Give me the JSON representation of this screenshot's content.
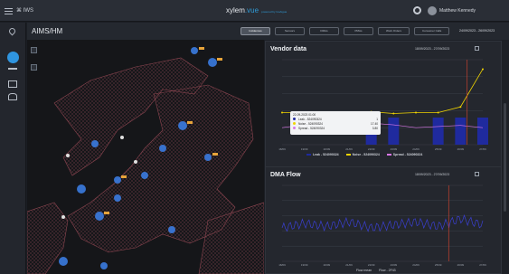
{
  "header": {
    "app_name": "IWS",
    "brand": "xylem",
    "brand_accent": "vue",
    "brand_tag": "powered by GoAigua",
    "user_name": "Matthew Kennedy"
  },
  "breadcrumb": "AIMS/HM",
  "tabs": [
    {
      "label": "Incidences",
      "active": true
    },
    {
      "label": "Sensors",
      "active": false
    },
    {
      "label": "DMAs",
      "active": false
    },
    {
      "label": "PMAs",
      "active": false
    },
    {
      "label": "Work Orders",
      "active": false
    },
    {
      "label": "Consumer Calls",
      "active": false
    }
  ],
  "global_date_range": "24/09/2023 - 26/09/2023",
  "vendor_panel": {
    "title": "Vendor data",
    "date_range": "18/09/2023 - 27/09/2023",
    "legend": [
      "Leak - 524090324",
      "Noise - 524090324",
      "Spread - 524090324"
    ],
    "tooltip": {
      "timestamp": "22-09-2023 01:00",
      "rows": [
        {
          "label": "Leak - 524090324",
          "value": "1"
        },
        {
          "label": "Noise - 524090324",
          "value": "17.40"
        },
        {
          "label": "Spread - 524090324",
          "value": "3.80"
        }
      ]
    }
  },
  "flow_panel": {
    "title": "DMA Flow",
    "date_range": "18/09/2023 - 27/09/2023",
    "legend": [
      "Flow mean",
      "Flow - 2F43"
    ]
  },
  "colors": {
    "accent": "#2f95e0",
    "leak": "#1f2a9e",
    "noise": "#f0d400",
    "spread": "#d977e6",
    "flow": "#3a3fd0",
    "alert": "#e0452f"
  },
  "icons": [
    "menu-icon",
    "flag-icon",
    "gear-icon",
    "calendar-icon",
    "pin-icon",
    "drop-icon",
    "truck-icon",
    "layers-icon",
    "bell-icon"
  ],
  "chart_data": [
    {
      "type": "bar",
      "title": "Vendor data",
      "categories": [
        "18/09",
        "19/09",
        "20/09",
        "21/09",
        "22/09",
        "23/09",
        "24/09",
        "25/09",
        "26/09",
        "27/09"
      ],
      "series": [
        {
          "name": "Leak - 524090324",
          "type": "bar",
          "values": [
            0,
            0,
            0,
            0,
            1,
            1,
            0,
            1,
            1,
            1
          ]
        },
        {
          "name": "Noise - 524090324",
          "type": "line",
          "values": [
            17,
            17,
            17,
            17,
            17.4,
            16.5,
            17,
            17,
            20,
            40
          ]
        },
        {
          "name": "Spread - 524090324",
          "type": "line",
          "values": [
            3,
            3.5,
            3,
            3.2,
            3.8,
            3.5,
            3,
            3.2,
            3.4,
            3
          ]
        }
      ]
    },
    {
      "type": "line",
      "title": "DMA Flow",
      "categories": [
        "18/09",
        "19/09",
        "20/09",
        "21/09",
        "22/09",
        "23/09",
        "24/09",
        "25/09",
        "26/09",
        "27/09"
      ],
      "series": [
        {
          "name": "Flow - 2F43",
          "values": [
            22,
            25,
            23,
            26,
            22,
            24,
            26,
            23,
            28,
            24
          ]
        }
      ]
    }
  ]
}
